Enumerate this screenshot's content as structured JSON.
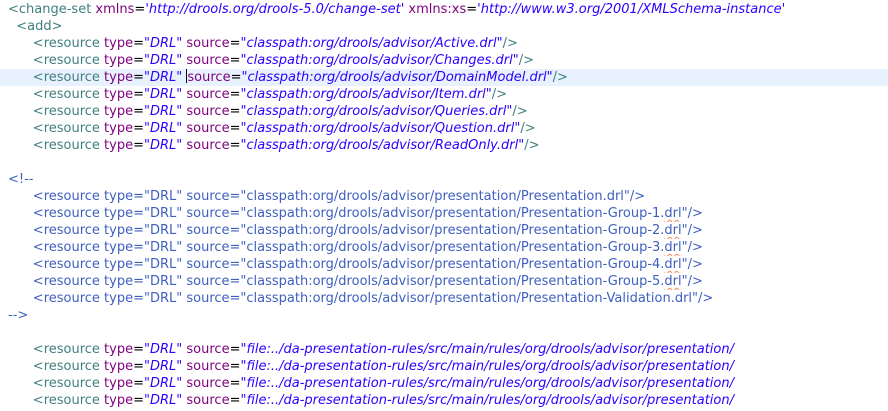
{
  "editor": {
    "lines": [
      {
        "indent": "",
        "parts": [
          {
            "t": "<change-set",
            "c": "tag"
          },
          {
            "t": " xmlns",
            "c": "attr"
          },
          {
            "t": "=",
            "c": "eq"
          },
          {
            "t": "'http://drools.org/drools-5.0/change-set'",
            "c": "val"
          },
          {
            "t": " xmlns:xs",
            "c": "attr"
          },
          {
            "t": "=",
            "c": "eq"
          },
          {
            "t": "'http://www.w3.org/2001/XMLSchema-instance'",
            "c": "val"
          }
        ]
      },
      {
        "indent": "  ",
        "parts": [
          {
            "t": "<add>",
            "c": "tag"
          }
        ]
      },
      {
        "indent": "      ",
        "parts": [
          {
            "t": "<resource",
            "c": "tag"
          },
          {
            "t": " type",
            "c": "attr"
          },
          {
            "t": "=",
            "c": "eq"
          },
          {
            "t": "\"DRL\"",
            "c": "val"
          },
          {
            "t": " source",
            "c": "attr"
          },
          {
            "t": "=",
            "c": "eq"
          },
          {
            "t": "\"classpath:org/drools/advisor/Active.drl\"",
            "c": "val"
          },
          {
            "t": "/>",
            "c": "tag"
          }
        ]
      },
      {
        "indent": "      ",
        "parts": [
          {
            "t": "<resource",
            "c": "tag"
          },
          {
            "t": " type",
            "c": "attr"
          },
          {
            "t": "=",
            "c": "eq"
          },
          {
            "t": "\"DRL\"",
            "c": "val"
          },
          {
            "t": " source",
            "c": "attr"
          },
          {
            "t": "=",
            "c": "eq"
          },
          {
            "t": "\"classpath:org/drools/advisor/Changes.drl\"",
            "c": "val"
          },
          {
            "t": "/>",
            "c": "tag"
          }
        ]
      },
      {
        "indent": "      ",
        "current": true,
        "parts": [
          {
            "t": "<resource",
            "c": "tag"
          },
          {
            "t": " type",
            "c": "attr"
          },
          {
            "t": "=",
            "c": "eq"
          },
          {
            "t": "\"DRL\"",
            "c": "val"
          },
          {
            "t": " ",
            "c": "eq"
          },
          {
            "t": "",
            "c": "caret"
          },
          {
            "t": "source",
            "c": "attr"
          },
          {
            "t": "=",
            "c": "eq"
          },
          {
            "t": "\"classpath:org/drools/advisor/DomainModel.drl\"",
            "c": "val"
          },
          {
            "t": "/>",
            "c": "tag"
          }
        ]
      },
      {
        "indent": "      ",
        "parts": [
          {
            "t": "<resource",
            "c": "tag"
          },
          {
            "t": " type",
            "c": "attr"
          },
          {
            "t": "=",
            "c": "eq"
          },
          {
            "t": "\"DRL\"",
            "c": "val"
          },
          {
            "t": " source",
            "c": "attr"
          },
          {
            "t": "=",
            "c": "eq"
          },
          {
            "t": "\"classpath:org/drools/advisor/Item.drl\"",
            "c": "val"
          },
          {
            "t": "/>",
            "c": "tag"
          }
        ]
      },
      {
        "indent": "      ",
        "parts": [
          {
            "t": "<resource",
            "c": "tag"
          },
          {
            "t": " type",
            "c": "attr"
          },
          {
            "t": "=",
            "c": "eq"
          },
          {
            "t": "\"DRL\"",
            "c": "val"
          },
          {
            "t": " source",
            "c": "attr"
          },
          {
            "t": "=",
            "c": "eq"
          },
          {
            "t": "\"classpath:org/drools/advisor/Queries.drl\"",
            "c": "val"
          },
          {
            "t": "/>",
            "c": "tag"
          }
        ]
      },
      {
        "indent": "      ",
        "parts": [
          {
            "t": "<resource",
            "c": "tag"
          },
          {
            "t": " type",
            "c": "attr"
          },
          {
            "t": "=",
            "c": "eq"
          },
          {
            "t": "\"DRL\"",
            "c": "val"
          },
          {
            "t": " source",
            "c": "attr"
          },
          {
            "t": "=",
            "c": "eq"
          },
          {
            "t": "\"classpath:org/drools/advisor/Question.drl\"",
            "c": "val"
          },
          {
            "t": "/>",
            "c": "tag"
          }
        ]
      },
      {
        "indent": "      ",
        "parts": [
          {
            "t": "<resource",
            "c": "tag"
          },
          {
            "t": " type",
            "c": "attr"
          },
          {
            "t": "=",
            "c": "eq"
          },
          {
            "t": "\"DRL\"",
            "c": "val"
          },
          {
            "t": " source",
            "c": "attr"
          },
          {
            "t": "=",
            "c": "eq"
          },
          {
            "t": "\"classpath:org/drools/advisor/ReadOnly.drl\"",
            "c": "val"
          },
          {
            "t": "/>",
            "c": "tag"
          }
        ]
      },
      {
        "indent": "",
        "parts": []
      },
      {
        "indent": "",
        "parts": [
          {
            "t": "<!--",
            "c": "cmt"
          }
        ]
      },
      {
        "indent": "      ",
        "parts": [
          {
            "t": "<resource type=\"DRL\" source=\"classpath:org/drools/advisor/presentation/Presentation.drl\"/>",
            "c": "cmt"
          }
        ]
      },
      {
        "indent": "      ",
        "parts": [
          {
            "t": "<resource type=\"DRL\" source=\"classpath:org/drools/advisor/presentation/Presentation-Group-1.",
            "c": "cmt"
          },
          {
            "t": "drl",
            "c": "cmt squig"
          },
          {
            "t": "\"/>",
            "c": "cmt"
          }
        ]
      },
      {
        "indent": "      ",
        "parts": [
          {
            "t": "<resource type=\"DRL\" source=\"classpath:org/drools/advisor/presentation/Presentation-Group-2.",
            "c": "cmt"
          },
          {
            "t": "drl",
            "c": "cmt squig"
          },
          {
            "t": "\"/>",
            "c": "cmt"
          }
        ]
      },
      {
        "indent": "      ",
        "parts": [
          {
            "t": "<resource type=\"DRL\" source=\"classpath:org/drools/advisor/presentation/Presentation-Group-3.",
            "c": "cmt"
          },
          {
            "t": "drl",
            "c": "cmt squig"
          },
          {
            "t": "\"/>",
            "c": "cmt"
          }
        ]
      },
      {
        "indent": "      ",
        "parts": [
          {
            "t": "<resource type=\"DRL\" source=\"classpath:org/drools/advisor/presentation/Presentation-Group-4.",
            "c": "cmt"
          },
          {
            "t": "drl",
            "c": "cmt squig"
          },
          {
            "t": "\"/>",
            "c": "cmt"
          }
        ]
      },
      {
        "indent": "      ",
        "parts": [
          {
            "t": "<resource type=\"DRL\" source=\"classpath:org/drools/advisor/presentation/Presentation-Group-5.",
            "c": "cmt"
          },
          {
            "t": "drl",
            "c": "cmt squig"
          },
          {
            "t": "\"/>",
            "c": "cmt"
          }
        ]
      },
      {
        "indent": "      ",
        "parts": [
          {
            "t": "<resource type=\"DRL\" source=\"classpath:org/drools/advisor/presentation/Presentation-Validation.drl\"/>",
            "c": "cmt"
          }
        ]
      },
      {
        "indent": "",
        "parts": [
          {
            "t": "-->",
            "c": "cmt"
          }
        ]
      },
      {
        "indent": "",
        "parts": []
      },
      {
        "indent": "      ",
        "parts": [
          {
            "t": "<resource",
            "c": "tag"
          },
          {
            "t": " type",
            "c": "attr"
          },
          {
            "t": "=",
            "c": "eq"
          },
          {
            "t": "\"DRL\"",
            "c": "val"
          },
          {
            "t": " source",
            "c": "attr"
          },
          {
            "t": "=",
            "c": "eq"
          },
          {
            "t": "\"file:../da-presentation-rules/src/main/rules/org/drools/advisor/presentation/",
            "c": "val"
          }
        ]
      },
      {
        "indent": "      ",
        "parts": [
          {
            "t": "<resource",
            "c": "tag"
          },
          {
            "t": " type",
            "c": "attr"
          },
          {
            "t": "=",
            "c": "eq"
          },
          {
            "t": "\"DRL\"",
            "c": "val"
          },
          {
            "t": " source",
            "c": "attr"
          },
          {
            "t": "=",
            "c": "eq"
          },
          {
            "t": "\"file:../da-presentation-rules/src/main/rules/org/drools/advisor/presentation/",
            "c": "val"
          }
        ]
      },
      {
        "indent": "      ",
        "parts": [
          {
            "t": "<resource",
            "c": "tag"
          },
          {
            "t": " type",
            "c": "attr"
          },
          {
            "t": "=",
            "c": "eq"
          },
          {
            "t": "\"DRL\"",
            "c": "val"
          },
          {
            "t": " source",
            "c": "attr"
          },
          {
            "t": "=",
            "c": "eq"
          },
          {
            "t": "\"file:../da-presentation-rules/src/main/rules/org/drools/advisor/presentation/",
            "c": "val"
          }
        ]
      },
      {
        "indent": "      ",
        "parts": [
          {
            "t": "<resource",
            "c": "tag"
          },
          {
            "t": " type",
            "c": "attr"
          },
          {
            "t": "=",
            "c": "eq"
          },
          {
            "t": "\"DRL\"",
            "c": "val"
          },
          {
            "t": " source",
            "c": "attr"
          },
          {
            "t": "=",
            "c": "eq"
          },
          {
            "t": "\"file:../da-presentation-rules/src/main/rules/org/drools/advisor/presentation/",
            "c": "val"
          }
        ]
      }
    ]
  },
  "colors": {
    "tag": "#3f7f7f",
    "attribute": "#7f007f",
    "value": "#2a00ff",
    "comment": "#3f5fbf",
    "current_line": "#e8f2fe",
    "spelling_squiggle": "#f08a5d"
  }
}
